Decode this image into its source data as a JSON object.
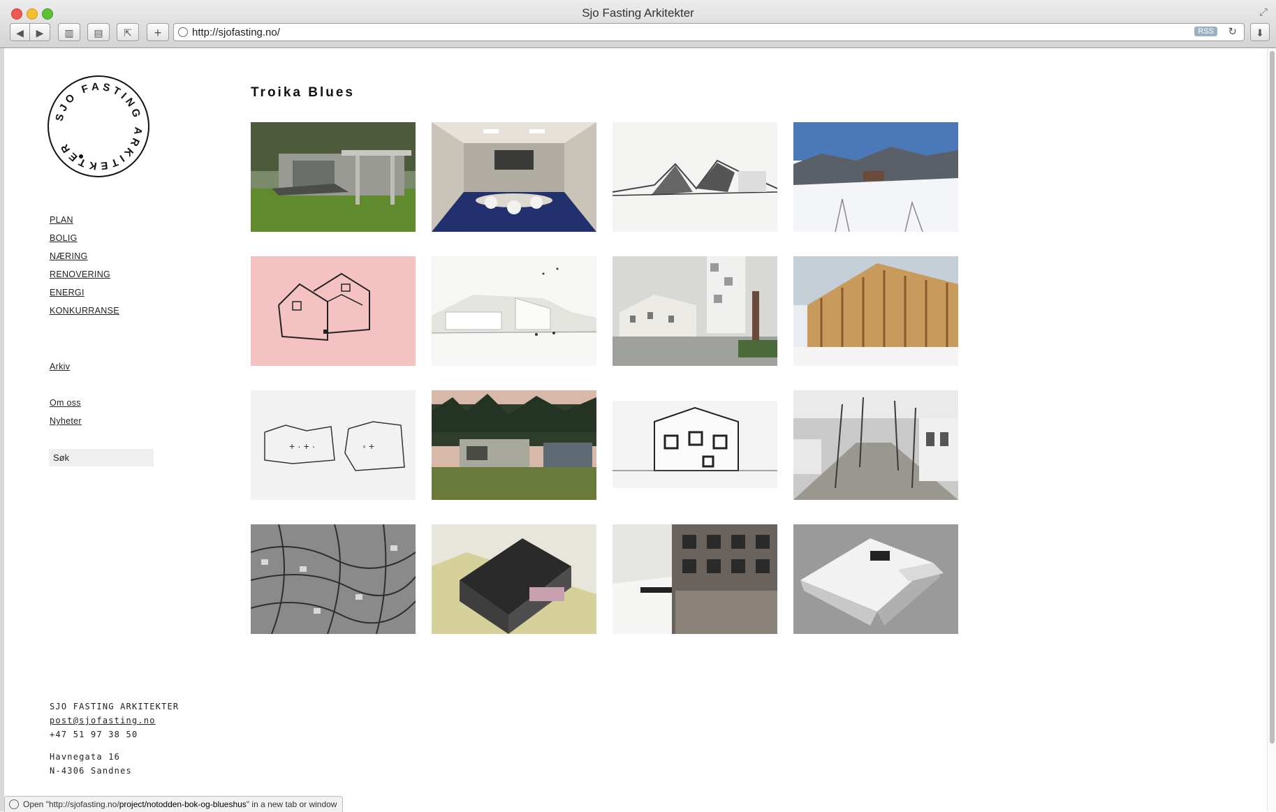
{
  "window": {
    "title": "Sjo Fasting Arkitekter"
  },
  "toolbar": {
    "url": "http://sjofasting.no/",
    "rss_label": "RSS",
    "add_label": "+"
  },
  "logo": {
    "text": "SJO FASTING ARKITEKTER"
  },
  "nav": {
    "items": [
      "PLAN",
      "BOLIG",
      "NÆRING",
      "RENOVERING",
      "ENERGI",
      "KONKURRANSE"
    ],
    "archive": "Arkiv",
    "about": "Om oss",
    "news": "Nyheter"
  },
  "search": {
    "placeholder": "Søk"
  },
  "footer": {
    "company": "SJO FASTING ARKITEKTER",
    "email": "post@sjofasting.no",
    "phone": "+47 51 97 38 50",
    "street": "Havnegata 16",
    "city": "N-4306 Sandnes"
  },
  "main": {
    "heading": "Troika Blues",
    "thumbnails": [
      "house-courtyard-photo",
      "meeting-room-photo",
      "section-sketch-drawing",
      "snowy-landscape-photo",
      "pink-house-sketch",
      "white-building-render",
      "town-square-render",
      "timber-frame-photo",
      "plan-sketch-drawing",
      "forest-houses-render",
      "facade-elevation-drawing",
      "tree-lined-path-photo",
      "aerial-map-photo",
      "black-model-photo",
      "brick-facade-render",
      "white-model-photo"
    ]
  },
  "status": {
    "prefix": "Open \"http://sjofasting.no/",
    "path": "project/notodden-bok-og-blueshus",
    "suffix": "\" in a new tab or window"
  }
}
